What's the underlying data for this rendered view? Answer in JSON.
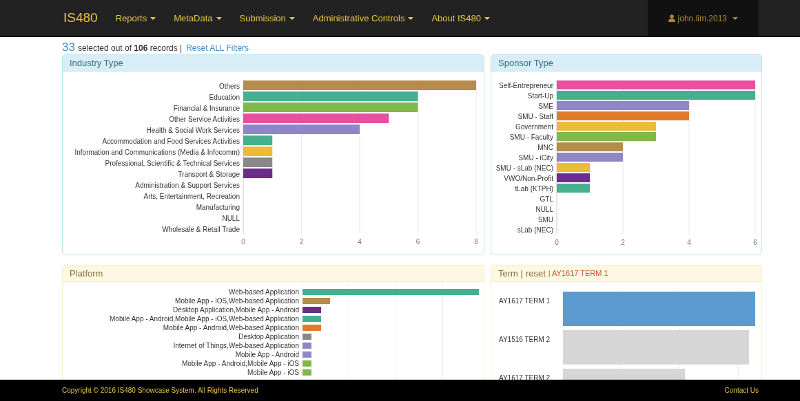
{
  "navbar": {
    "brand": "IS480",
    "menus": [
      {
        "label": "Reports"
      },
      {
        "label": "MetaData"
      },
      {
        "label": "Submission"
      },
      {
        "label": "Administrative Controls"
      },
      {
        "label": "About IS480"
      }
    ],
    "user": "john.lim.2013"
  },
  "summary": {
    "selected": "33",
    "text": "selected out of **106** records |",
    "reset_link": "Reset ALL Filters"
  },
  "industry": {
    "title": "Industry Type",
    "chart_data": {
      "type": "bar",
      "orientation": "horizontal",
      "categories": [
        "Others",
        "Education",
        "Financial & Insurance",
        "Other Service Activities",
        "Health & Social Work Services",
        "Accommodation and Food Services Activities",
        "Information and Communications (Media & Infocomm)",
        "Professional, Scientific & Technical Services",
        "Transport & Storage",
        "Administration & Support Services",
        "Arts, Entertainment, Recreation",
        "Manufacturing",
        "NULL",
        "Wholesale & Retail Trade"
      ],
      "values": [
        8,
        6,
        6,
        5,
        4,
        1,
        1,
        1,
        1,
        0,
        0,
        0,
        0,
        0
      ],
      "colors": [
        "#b58c4c",
        "#45b08f",
        "#80b84b",
        "#e84f9f",
        "#8f87c5",
        "#45b08f",
        "#ecbb3a",
        "#888888",
        "#6b2d8a",
        null,
        null,
        null,
        null,
        null
      ],
      "grid": true,
      "xlim": [
        0,
        8
      ],
      "xticks": [
        0,
        2,
        4,
        6,
        8
      ]
    }
  },
  "sponsor": {
    "title": "Sponsor Type",
    "chart_data": {
      "type": "bar",
      "orientation": "horizontal",
      "categories": [
        "Self-Entrepreneur",
        "Start-Up",
        "SME",
        "SMU - Staff",
        "Government",
        "SMU - Faculty",
        "MNC",
        "SMU - iCity",
        "SMU - sLab (NEC)",
        "VWO/Non-Profit",
        "tLab (KTPH)",
        "GTL",
        "NULL",
        "SMU",
        "sLab (NEC)"
      ],
      "values": [
        6,
        6,
        4,
        4,
        3,
        3,
        2,
        2,
        1,
        1,
        1,
        0,
        0,
        0,
        0
      ],
      "colors": [
        "#e84f9f",
        "#45b08f",
        "#8f87c5",
        "#e07b2e",
        "#ecbb3a",
        "#80b84b",
        "#b58c4c",
        "#8f87c5",
        "#ecbb3a",
        "#6b2d8a",
        "#45b08f",
        null,
        null,
        null,
        null
      ],
      "grid": true,
      "xlim": [
        0,
        6
      ],
      "xticks": [
        0,
        2,
        4,
        6
      ]
    }
  },
  "platform": {
    "title": "Platform",
    "rows": [
      {
        "label": "Web-based Application",
        "color": "#45b08f"
      },
      {
        "label": "Mobile App - iOS,Web-based Application",
        "color": "#b58c4c"
      },
      {
        "label": "Desktop Application,Mobile App - Android",
        "color": "#6b2d8a"
      },
      {
        "label": "Mobile App - Android,Mobile App - iOS,Web-based Application",
        "color": "#45b08f"
      },
      {
        "label": "Mobile App - Android,Web-based Application",
        "color": "#e07b2e"
      },
      {
        "label": "Desktop Application",
        "color": "#888888"
      },
      {
        "label": "Internet of Things,Web-based Application",
        "color": "#8f87c5"
      },
      {
        "label": "Mobile App - Android",
        "color": "#8f87c5"
      },
      {
        "label": "Mobile App - Android,Mobile App - iOS",
        "color": "#80b84b"
      },
      {
        "label": "Mobile App - iOS",
        "color": "#80b84b"
      }
    ]
  },
  "term": {
    "title": "Term |",
    "reset": "reset",
    "filter": "| AY1617 TERM 1",
    "rows": [
      {
        "label": "AY1617 TERM 1",
        "selected": true
      },
      {
        "label": "AY1516 TERM 2",
        "selected": false
      },
      {
        "label": "AY1617 TERM 2",
        "selected": false
      }
    ]
  },
  "footer": {
    "copyright": "Copyright © 2016 IS480 Showcase System. All Rights Reserved",
    "contact": "Contact Us"
  }
}
